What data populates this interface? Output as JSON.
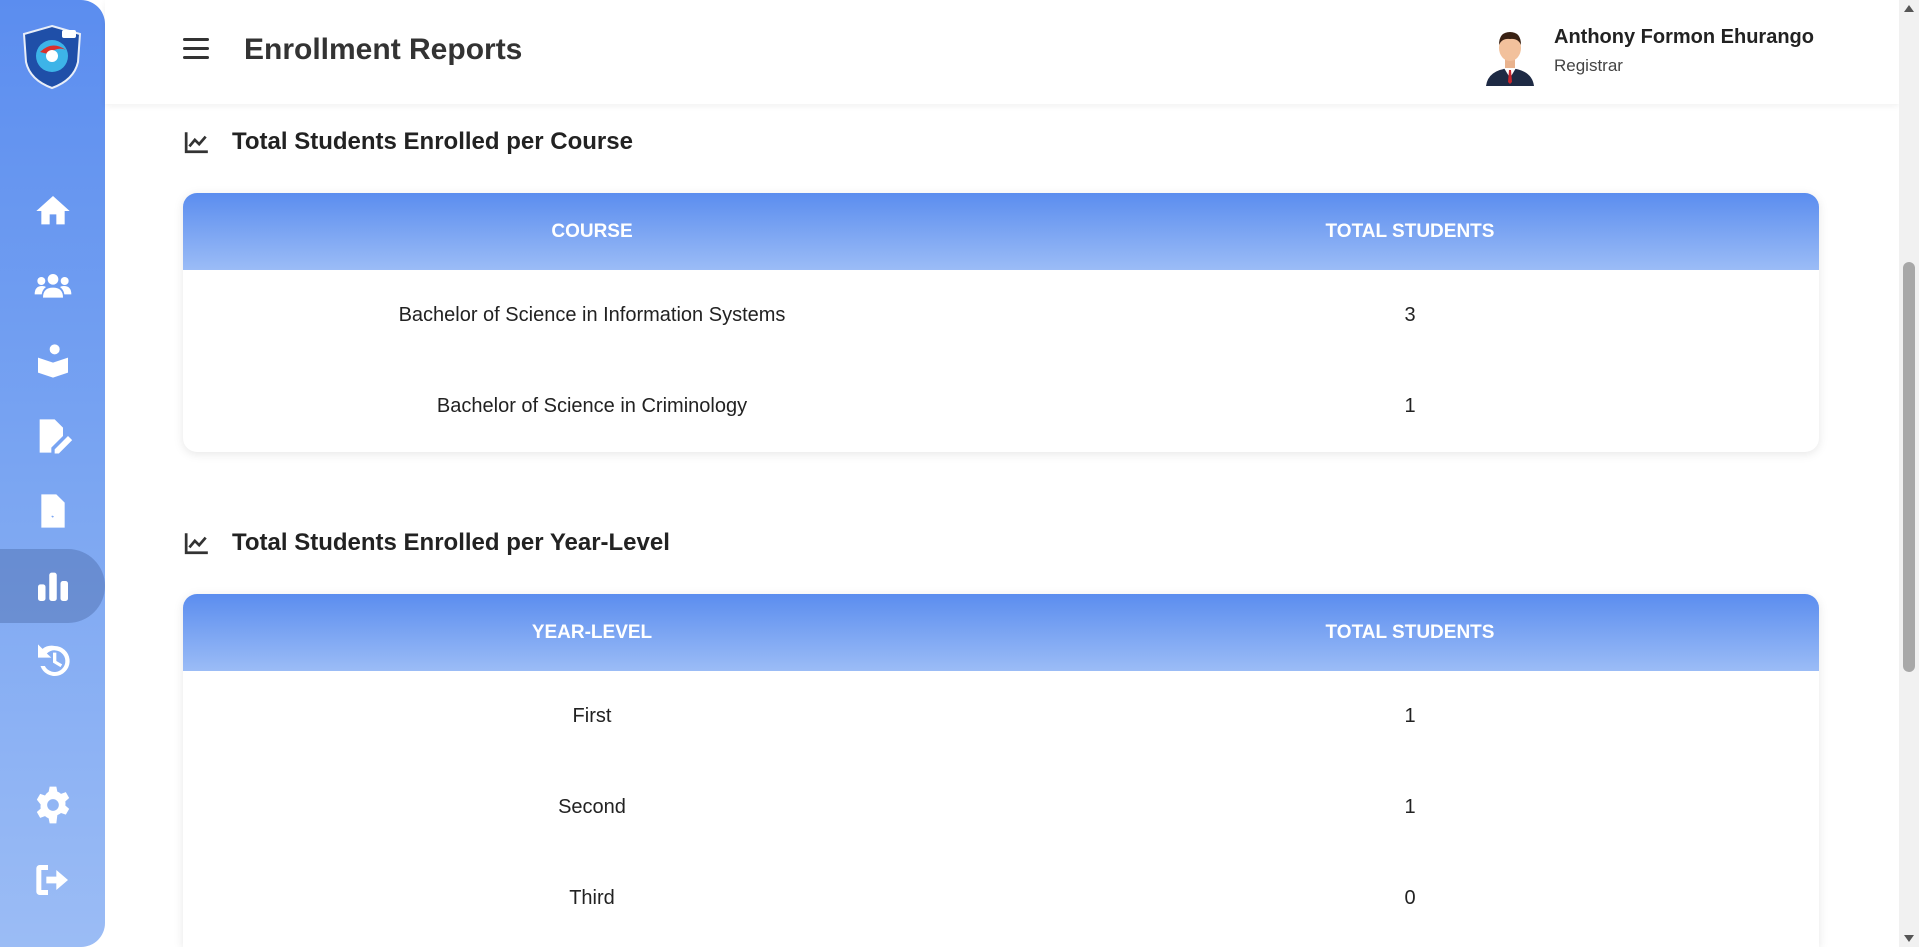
{
  "header": {
    "title": "Enrollment Reports",
    "user_name": "Anthony Formon Ehurango",
    "user_role": "Registrar"
  },
  "sidebar": {
    "items": [
      {
        "icon": "home-icon"
      },
      {
        "icon": "users-icon"
      },
      {
        "icon": "student-icon"
      },
      {
        "icon": "file-edit-icon"
      },
      {
        "icon": "file-report-icon"
      },
      {
        "icon": "bar-chart-icon",
        "active": true
      },
      {
        "icon": "history-icon"
      },
      {
        "icon": "gear-icon"
      },
      {
        "icon": "logout-icon"
      }
    ]
  },
  "course_section": {
    "title": "Total Students Enrolled per Course",
    "headers": [
      "COURSE",
      "TOTAL STUDENTS"
    ],
    "rows": [
      {
        "name": "Bachelor of Science in Information Systems",
        "total": "3"
      },
      {
        "name": "Bachelor of Science in Criminology",
        "total": "1"
      }
    ]
  },
  "year_section": {
    "title": "Total Students Enrolled per Year-Level",
    "headers": [
      "YEAR-LEVEL",
      "TOTAL STUDENTS"
    ],
    "rows": [
      {
        "name": "First",
        "total": "1"
      },
      {
        "name": "Second",
        "total": "1"
      },
      {
        "name": "Third",
        "total": "0"
      }
    ]
  },
  "colors": {
    "accent": "#5b8def",
    "accent_light": "#9bbcf5"
  }
}
